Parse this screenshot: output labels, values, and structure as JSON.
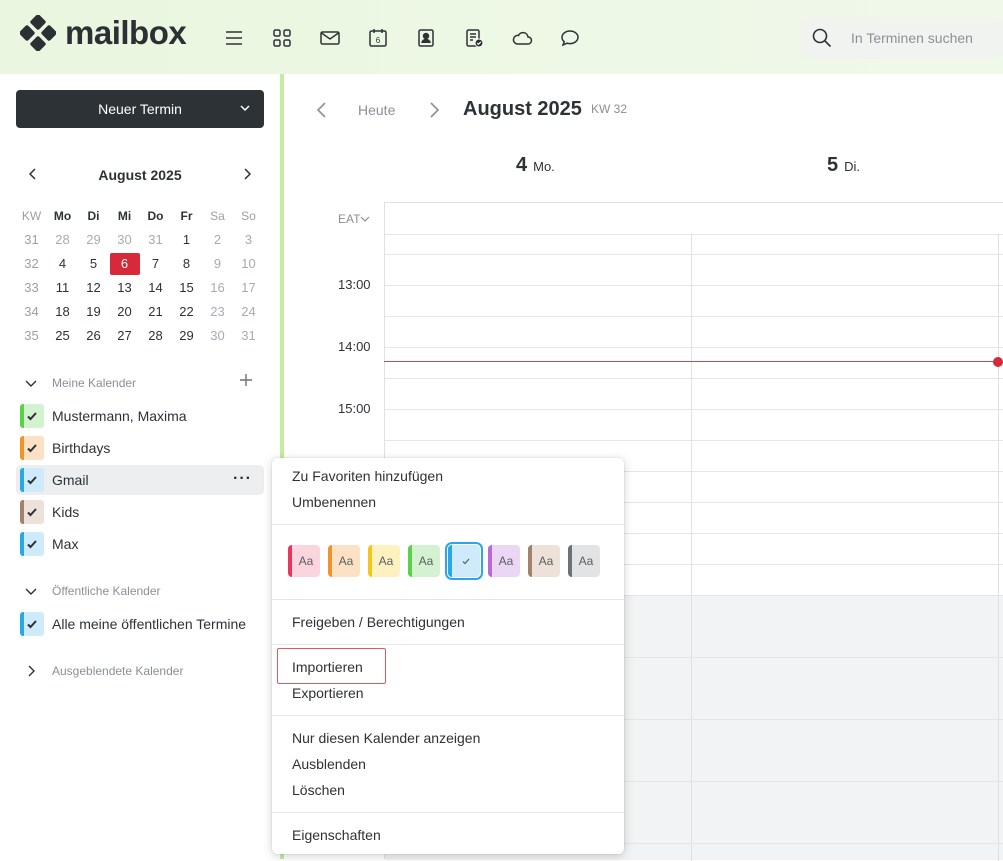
{
  "app": {
    "logo_text": "mailbox"
  },
  "search": {
    "placeholder": "In Terminen suchen"
  },
  "toolbar_icons": [
    "menu-icon",
    "apps-grid-icon",
    "mail-icon",
    "calendar-icon",
    "contacts-icon",
    "tasks-icon",
    "cloud-icon",
    "chat-icon"
  ],
  "sidebar": {
    "new_event_label": "Neuer Termin",
    "mini_calendar": {
      "title": "August 2025",
      "headers": [
        "KW",
        "Mo",
        "Di",
        "Mi",
        "Do",
        "Fr",
        "Sa",
        "So"
      ],
      "weeks": [
        [
          "31",
          "28",
          "29",
          "30",
          "31",
          "1",
          "2",
          "3"
        ],
        [
          "32",
          "4",
          "5",
          "6",
          "7",
          "8",
          "9",
          "10"
        ],
        [
          "33",
          "11",
          "12",
          "13",
          "14",
          "15",
          "16",
          "17"
        ],
        [
          "34",
          "18",
          "19",
          "20",
          "21",
          "22",
          "23",
          "24"
        ],
        [
          "35",
          "25",
          "26",
          "27",
          "28",
          "29",
          "30",
          "31"
        ]
      ],
      "today": "6"
    },
    "sections": {
      "my_calendars": "Meine Kalender",
      "public_calendars": "Öffentliche Kalender",
      "hidden_calendars": "Ausgeblendete Kalender"
    },
    "my_calendars": [
      {
        "label": "Mustermann, Maxima",
        "color": "#5bd14b"
      },
      {
        "label": "Birthdays",
        "color": "#f0942a"
      },
      {
        "label": "Gmail",
        "color": "#2aa7e6"
      },
      {
        "label": "Kids",
        "color": "#a0826d"
      },
      {
        "label": "Max",
        "color": "#2aa7e6"
      }
    ],
    "public_calendars": [
      {
        "label": "Alle meine öffentlichen Termine",
        "color": "#2aa7e6"
      }
    ]
  },
  "main": {
    "today_label": "Heute",
    "month_title": "August 2025",
    "week_label": "KW 32",
    "days": [
      {
        "num": "4",
        "name": "Mo."
      },
      {
        "num": "5",
        "name": "Di."
      }
    ],
    "timezone": "EAT",
    "times": [
      "13:00",
      "14:00",
      "15:00"
    ]
  },
  "context_menu": {
    "add_favorites": "Zu Favoriten hinzufügen",
    "rename": "Umbenennen",
    "swatch_text": "Aa",
    "swatches": [
      {
        "bar": "#e8365d",
        "bg": "#fbd5de"
      },
      {
        "bar": "#f0942a",
        "bg": "#fde1c4"
      },
      {
        "bar": "#f3c61e",
        "bg": "#fdf1c0"
      },
      {
        "bar": "#5bd14b",
        "bg": "#d4f2cf"
      },
      {
        "bar": "#2aa7e6",
        "bg": "#cfeafb",
        "selected": true
      },
      {
        "bar": "#b66bd6",
        "bg": "#ecd6f6"
      },
      {
        "bar": "#a0826d",
        "bg": "#ece2da"
      },
      {
        "bar": "#6c7175",
        "bg": "#e1e3e4"
      }
    ],
    "share": "Freigeben / Berechtigungen",
    "import": "Importieren",
    "export": "Exportieren",
    "only_this": "Nur diesen Kalender anzeigen",
    "hide": "Ausblenden",
    "delete": "Löschen",
    "properties": "Eigenschaften"
  }
}
